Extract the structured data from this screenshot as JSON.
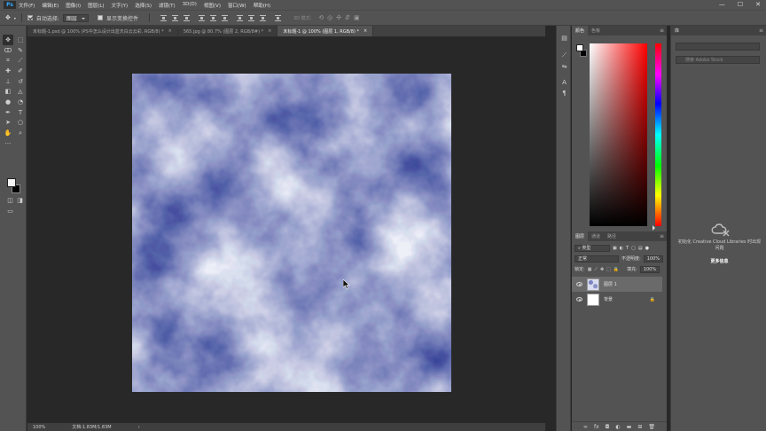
{
  "menubar": {
    "logo": "Ps",
    "items": [
      "文件(F)",
      "编辑(E)",
      "图像(I)",
      "图层(L)",
      "文字(Y)",
      "选择(S)",
      "滤镜(T)",
      "3D(D)",
      "视图(V)",
      "窗口(W)",
      "帮助(H)"
    ],
    "window_controls": [
      "—",
      "☐",
      "✕"
    ]
  },
  "options": {
    "auto_select_label": "自动选择:",
    "auto_select_checked": true,
    "target_value": "图层",
    "show_transform_label": "显示变换控件",
    "mode3d_label": "3D 模式:"
  },
  "tabs": [
    {
      "label": "未标题-1.psd @ 100% (PS中怎么设计出蓝天白云云彩, RGB/8) *",
      "active": false
    },
    {
      "label": "565.jpg @ 80.7% (图层 2, RGB/8#) *",
      "active": false
    },
    {
      "label": "未标题-1 @ 100% (图层 1, RGB/8) *",
      "active": true
    }
  ],
  "status": {
    "zoom": "100%",
    "doc": "文档:1.83M/1.83M"
  },
  "color_panel": {
    "tabs": [
      "颜色",
      "色板"
    ]
  },
  "layers_panel": {
    "tabs": [
      "图层",
      "通道",
      "路径"
    ],
    "kind_label": "类型",
    "blend_mode": "正常",
    "opacity_label": "不透明度:",
    "opacity_value": "100%",
    "lock_label": "锁定:",
    "fill_label": "填充:",
    "fill_value": "100%",
    "layers": [
      {
        "name": "图层 1",
        "active": true
      },
      {
        "name": "背景",
        "active": false
      }
    ]
  },
  "libraries_panel": {
    "title": "库",
    "search_placeholder": "搜索 Adobe Stock",
    "init_text": "初始化 Creative Cloud Libraries 时出现问题",
    "more_info": "更多信息"
  }
}
